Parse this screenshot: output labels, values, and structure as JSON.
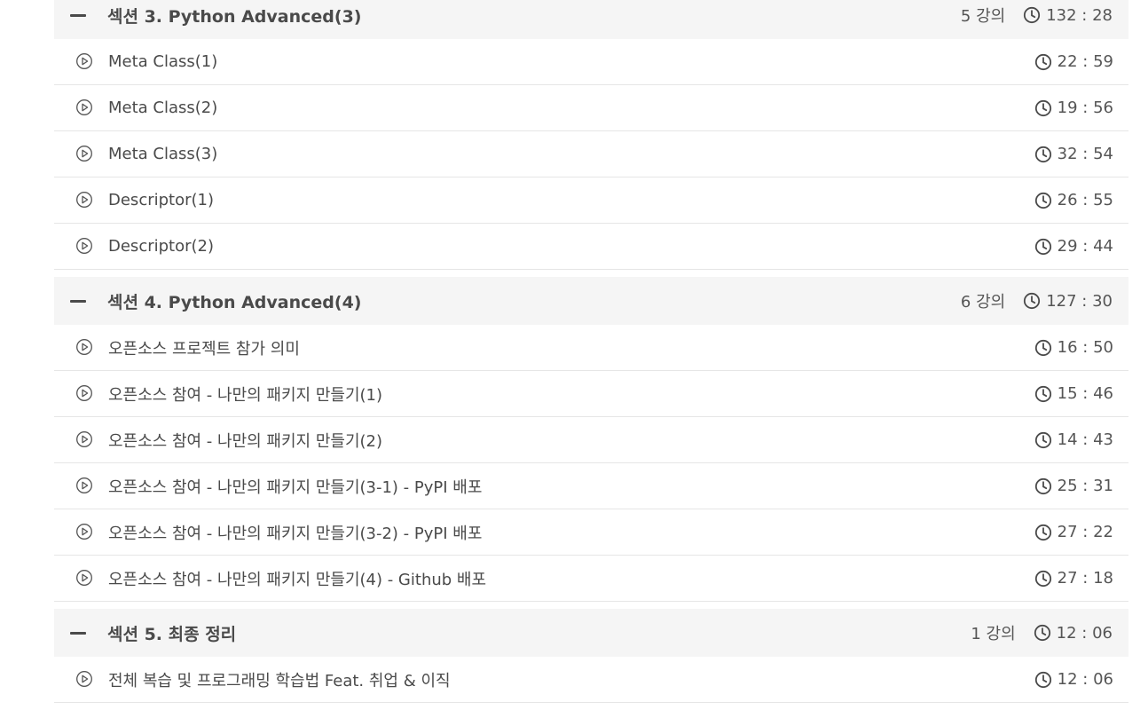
{
  "sections": [
    {
      "title": "섹션 3. Python Advanced(3)",
      "lecture_count": "5 강의",
      "duration": "132 : 28",
      "lectures": [
        {
          "title": "Meta Class(1)",
          "duration": "22 : 59"
        },
        {
          "title": "Meta Class(2)",
          "duration": "19 : 56"
        },
        {
          "title": "Meta Class(3)",
          "duration": "32 : 54"
        },
        {
          "title": "Descriptor(1)",
          "duration": "26 : 55"
        },
        {
          "title": "Descriptor(2)",
          "duration": "29 : 44"
        }
      ]
    },
    {
      "title": "섹션 4. Python Advanced(4)",
      "lecture_count": "6 강의",
      "duration": "127 : 30",
      "lectures": [
        {
          "title": "오픈소스 프로젝트 참가 의미",
          "duration": "16 : 50"
        },
        {
          "title": "오픈소스 참여 - 나만의 패키지 만들기(1)",
          "duration": "15 : 46"
        },
        {
          "title": "오픈소스 참여 - 나만의 패키지 만들기(2)",
          "duration": "14 : 43"
        },
        {
          "title": "오픈소스 참여 - 나만의 패키지 만들기(3-1) - PyPI 배포",
          "duration": "25 : 31"
        },
        {
          "title": "오픈소스 참여 - 나만의 패키지 만들기(3-2) - PyPI 배포",
          "duration": "27 : 22"
        },
        {
          "title": "오픈소스 참여 - 나만의 패키지 만들기(4) - Github 배포",
          "duration": "27 : 18"
        }
      ]
    },
    {
      "title": "섹션 5. 최종 정리",
      "lecture_count": "1 강의",
      "duration": "12 : 06",
      "lectures": [
        {
          "title": "전체 복습 및 프로그래밍 학습법 Feat. 취업 & 이직",
          "duration": "12 : 06"
        }
      ]
    }
  ],
  "icons": {
    "collapse": "minus-icon",
    "lecture": "play-circle-icon",
    "duration": "clock-icon"
  },
  "colors": {
    "section_bg": "#f5f5f5",
    "text": "#4a4a4a",
    "divider": "#e6e6e6"
  }
}
